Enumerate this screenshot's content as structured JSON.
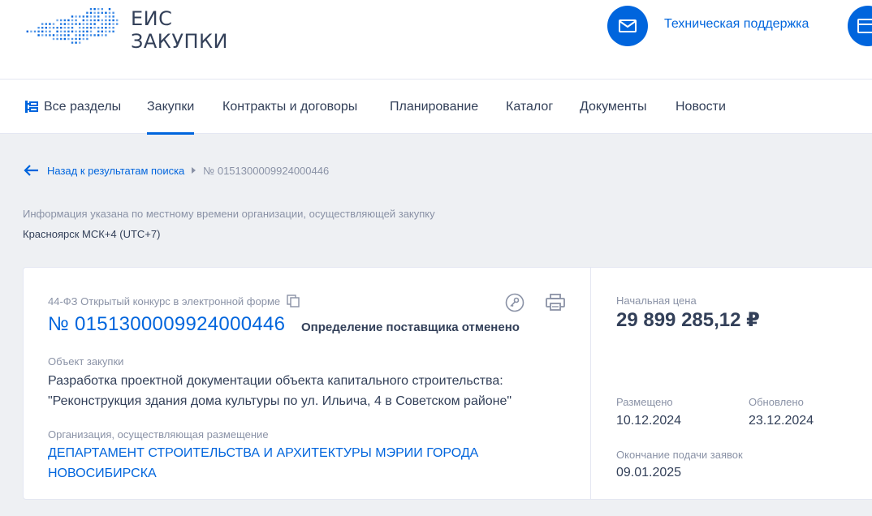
{
  "header": {
    "logo_line1": "ЕИС",
    "logo_line2": "ЗАКУПКИ",
    "support_label": "Техническая поддержка",
    "colors": {
      "brand": "#0065dd",
      "text": "#334059",
      "muted": "#8a92a6"
    },
    "icons": [
      "logo-map-icon",
      "mail-icon",
      "window-icon"
    ]
  },
  "nav": {
    "all_sections": "Все разделы",
    "items": [
      "Закупки",
      "Контракты и договоры",
      "Планирование",
      "Каталог",
      "Документы",
      "Новости"
    ],
    "active": "Закупки"
  },
  "breadcrumb": {
    "back": "Назад к результатам поиска",
    "current": "№ 0151300009924000446"
  },
  "timezone": {
    "note": "Информация указана по местному времени организации, осуществляющей закупку",
    "value": "Красноярск МСК+4 (UTC+7)"
  },
  "card": {
    "law_type": "44-ФЗ Открытый конкурс в электронной форме",
    "number": "№ 0151300009924000446",
    "status": "Определение поставщика отменено",
    "object_label": "Объект закупки",
    "object_text": "Разработка проектной документации объекта капитального строительства: \"Реконструкция здания дома культуры по ул. Ильича, 4 в Советском районе\"",
    "org_label": "Организация, осуществляющая размещение",
    "org_name": "ДЕПАРТАМЕНТ СТРОИТЕЛЬСТВА И АРХИТЕКТУРЫ МЭРИИ ГОРОДА НОВОСИБИРСКА",
    "price_label": "Начальная цена",
    "price": "29 899 285,12 ₽",
    "posted_label": "Размещено",
    "posted": "10.12.2024",
    "updated_label": "Обновлено",
    "updated": "23.12.2024",
    "deadline_label": "Окончание подачи заявок",
    "deadline": "09.01.2025"
  }
}
